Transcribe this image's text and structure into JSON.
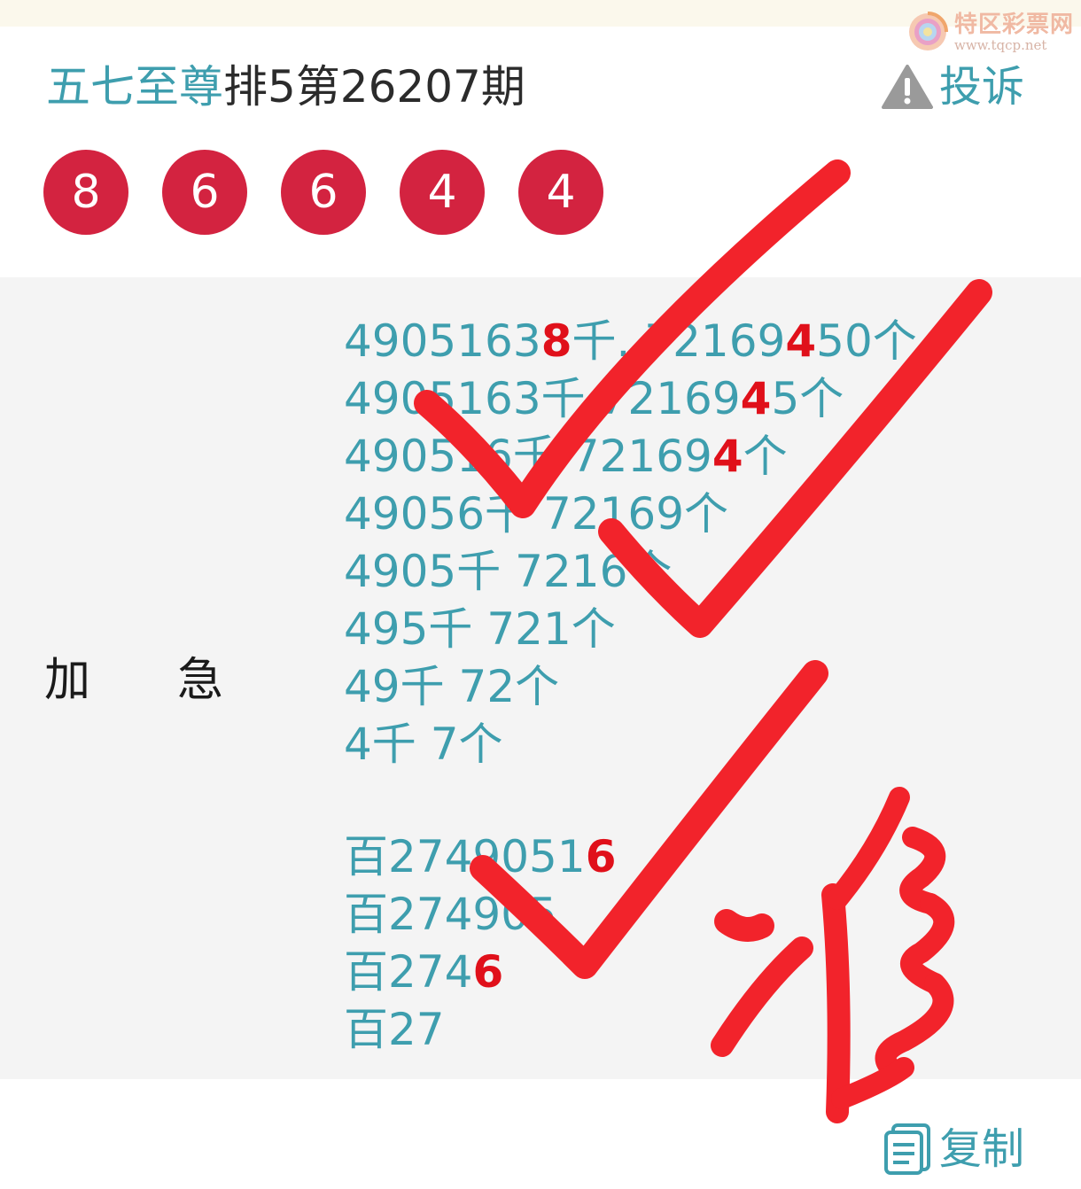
{
  "watermark": {
    "name": "特区彩票网",
    "url": "www.tqcp.net"
  },
  "header": {
    "author": "五七至尊",
    "issue": "排5第26207期",
    "complain_label": "投诉"
  },
  "balls": [
    "8",
    "6",
    "6",
    "4",
    "4"
  ],
  "content": {
    "label_left": "加",
    "label_right": "急",
    "lines": [
      [
        {
          "t": "4905163"
        },
        {
          "t": "8",
          "hl": true
        },
        {
          "t": "千. 72169"
        },
        {
          "t": "4",
          "hl": true
        },
        {
          "t": "50个"
        }
      ],
      [
        {
          "t": "4905163千 72169"
        },
        {
          "t": "4",
          "hl": true
        },
        {
          "t": "5个"
        }
      ],
      [
        {
          "t": "490516千 72169"
        },
        {
          "t": "4",
          "hl": true
        },
        {
          "t": "个"
        }
      ],
      [
        {
          "t": "49056千 72169个"
        }
      ],
      [
        {
          "t": "4905千 7216个"
        }
      ],
      [
        {
          "t": "495千 721个"
        }
      ],
      [
        {
          "t": "49千 72个"
        }
      ],
      [
        {
          "t": "4千 7个"
        }
      ]
    ],
    "lines2": [
      [
        {
          "t": "百2749051"
        },
        {
          "t": "6",
          "hl": true
        }
      ],
      [
        {
          "t": "百274905"
        }
      ],
      [
        {
          "t": "百274"
        },
        {
          "t": "6",
          "hl": true
        }
      ],
      [
        {
          "t": "百27"
        }
      ]
    ]
  },
  "footer": {
    "copy_label": "复制"
  },
  "colors": {
    "teal": "#3e9eae",
    "ball": "#d32340",
    "highlight": "#e0101a",
    "ink": "#f2232b"
  }
}
